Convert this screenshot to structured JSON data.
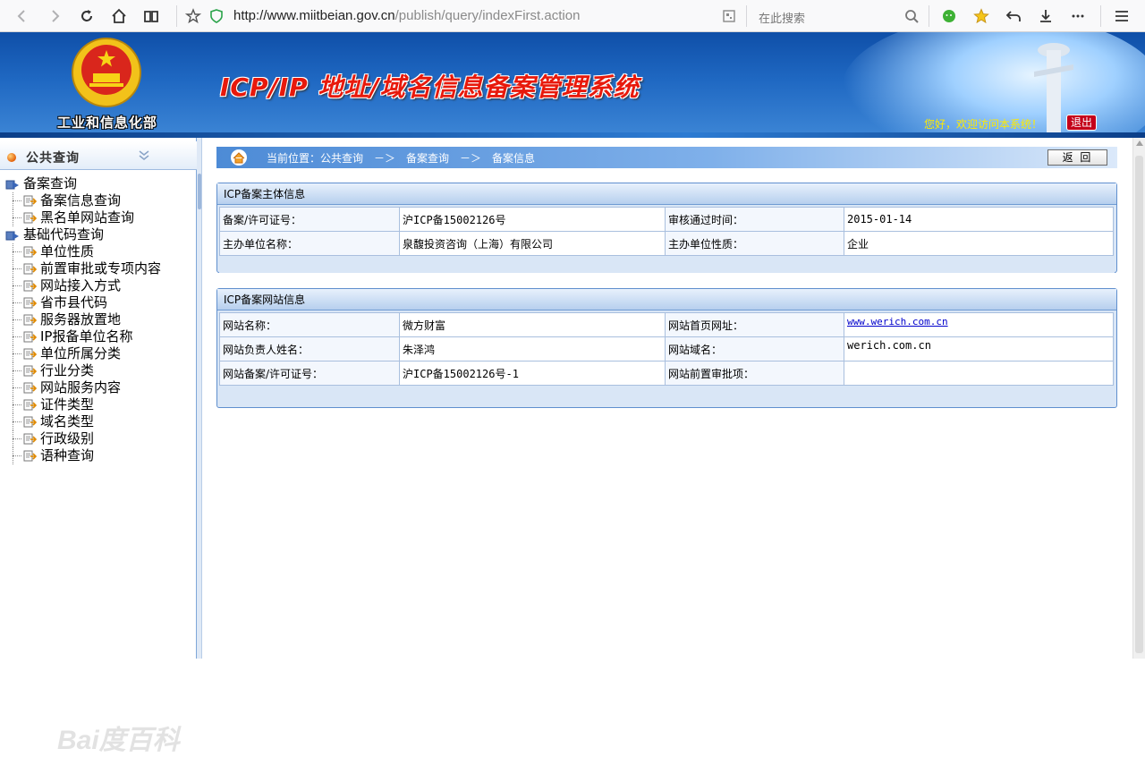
{
  "browser": {
    "url_host": "http://www.miitbeian.gov.cn",
    "url_path": "/publish/query/indexFirst.action",
    "search_placeholder": "在此搜索"
  },
  "banner": {
    "ministry": "工业和信息化部",
    "title": "ICP/IP 地址/域名信息备案管理系统",
    "welcome": "您好，欢迎访问本系统！",
    "logout": "退出"
  },
  "sidebar": {
    "title": "公共查询",
    "tree": [
      {
        "label": "备案查询",
        "level": 1
      },
      {
        "label": "备案信息查询",
        "level": 2
      },
      {
        "label": "黑名单网站查询",
        "level": 2
      },
      {
        "label": "基础代码查询",
        "level": 1
      },
      {
        "label": "单位性质",
        "level": 2
      },
      {
        "label": "前置审批或专项内容",
        "level": 2
      },
      {
        "label": "网站接入方式",
        "level": 2
      },
      {
        "label": "省市县代码",
        "level": 2
      },
      {
        "label": "服务器放置地",
        "level": 2
      },
      {
        "label": "IP报备单位名称",
        "level": 2
      },
      {
        "label": "单位所属分类",
        "level": 2
      },
      {
        "label": "行业分类",
        "level": 2
      },
      {
        "label": "网站服务内容",
        "level": 2
      },
      {
        "label": "证件类型",
        "level": 2
      },
      {
        "label": "域名类型",
        "level": 2
      },
      {
        "label": "行政级别",
        "level": 2
      },
      {
        "label": "语种查询",
        "level": 2
      }
    ],
    "watermark": "Bai度百科"
  },
  "breadcrumb": {
    "prefix": "当前位置：公共查询",
    "arrow1": "－＞",
    "item2": "备案查询",
    "arrow2": "－＞",
    "item3": "备案信息"
  },
  "back_button": "返 回",
  "subject_panel": {
    "title": "ICP备案主体信息",
    "rows": [
      [
        "备案/许可证号：",
        "沪ICP备15002126号",
        "审核通过时间：",
        "2015-01-14"
      ],
      [
        "主办单位名称：",
        "泉馥投资咨询（上海）有限公司",
        "主办单位性质：",
        "企业"
      ]
    ]
  },
  "site_panel": {
    "title": "ICP备案网站信息",
    "rows": [
      [
        "网站名称：",
        "微方财富",
        "网站首页网址：",
        "www.werich.com.cn"
      ],
      [
        "网站负责人姓名：",
        "朱泽鸿",
        "网站域名：",
        "werich.com.cn"
      ],
      [
        "网站备案/许可证号：",
        "沪ICP备15002126号-1",
        "网站前置审批项：",
        ""
      ]
    ]
  }
}
